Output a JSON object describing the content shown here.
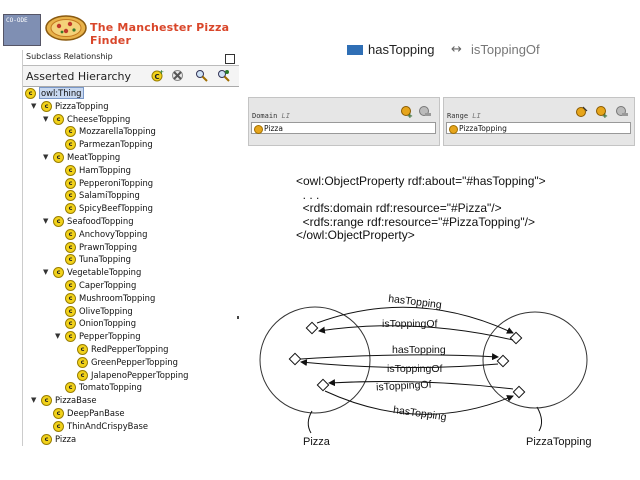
{
  "banner": {
    "logo_text": "CO-ODE",
    "title": "The Manchester Pizza Finder"
  },
  "panel": {
    "tab_label": "Subclass Relationship",
    "header_title": "Asserted Hierarchy",
    "icons": [
      "add-subclass-icon",
      "delete-class-icon",
      "find-icon",
      "find-next-icon"
    ]
  },
  "tree": [
    {
      "label": "owl:Thing",
      "level": 0,
      "toggle": "",
      "selected": true
    },
    {
      "label": "PizzaTopping",
      "level": 1,
      "toggle": "▼"
    },
    {
      "label": "CheeseTopping",
      "level": 2,
      "toggle": "▼"
    },
    {
      "label": "MozzarellaTopping",
      "level": 3,
      "toggle": ""
    },
    {
      "label": "ParmezanTopping",
      "level": 3,
      "toggle": ""
    },
    {
      "label": "MeatTopping",
      "level": 2,
      "toggle": "▼"
    },
    {
      "label": "HamTopping",
      "level": 3,
      "toggle": ""
    },
    {
      "label": "PepperoniTopping",
      "level": 3,
      "toggle": ""
    },
    {
      "label": "SalamiTopping",
      "level": 3,
      "toggle": ""
    },
    {
      "label": "SpicyBeefTopping",
      "level": 3,
      "toggle": ""
    },
    {
      "label": "SeafoodTopping",
      "level": 2,
      "toggle": "▼"
    },
    {
      "label": "AnchovyTopping",
      "level": 3,
      "toggle": ""
    },
    {
      "label": "PrawnTopping",
      "level": 3,
      "toggle": ""
    },
    {
      "label": "TunaTopping",
      "level": 3,
      "toggle": ""
    },
    {
      "label": "VegetableTopping",
      "level": 2,
      "toggle": "▼"
    },
    {
      "label": "CaperTopping",
      "level": 3,
      "toggle": ""
    },
    {
      "label": "MushroomTopping",
      "level": 3,
      "toggle": ""
    },
    {
      "label": "OliveTopping",
      "level": 3,
      "toggle": ""
    },
    {
      "label": "OnionTopping",
      "level": 3,
      "toggle": ""
    },
    {
      "label": "PepperTopping",
      "level": 3,
      "toggle": "▼"
    },
    {
      "label": "RedPepperTopping",
      "level": 4,
      "toggle": ""
    },
    {
      "label": "GreenPepperTopping",
      "level": 4,
      "toggle": ""
    },
    {
      "label": "JalapenoPepperTopping",
      "level": 4,
      "toggle": ""
    },
    {
      "label": "TomatoTopping",
      "level": 3,
      "toggle": ""
    },
    {
      "label": "PizzaBase",
      "level": 1,
      "toggle": "▼"
    },
    {
      "label": "DeepPanBase",
      "level": 2,
      "toggle": ""
    },
    {
      "label": "ThinAndCrispyBase",
      "level": 2,
      "toggle": ""
    },
    {
      "label": "Pizza",
      "level": 1,
      "toggle": ""
    }
  ],
  "property": {
    "name": "hasTopping",
    "arrow": "↔",
    "inverse": "isToppingOf",
    "color": "#2f6fb5"
  },
  "domain": {
    "header": "Domain",
    "header_suffix": "LI",
    "value": "Pizza"
  },
  "range": {
    "header": "Range",
    "header_suffix": "LI",
    "value": "PizzaTopping"
  },
  "owl_code": [
    "<owl:ObjectProperty rdf:about=\"#hasTopping\">",
    "  . . .",
    "  <rdfs:domain rdf:resource=\"#Pizza\"/>",
    "  <rdfs:range rdf:resource=\"#PizzaTopping\"/>",
    "</owl:ObjectProperty>"
  ],
  "diagram": {
    "left_label": "Pizza",
    "right_label": "PizzaTopping",
    "edge_labels": [
      "hasTopping",
      "isToppingOf",
      "hasTopping",
      "isToppingOf",
      "isToppingOf",
      "hasTopping"
    ]
  }
}
